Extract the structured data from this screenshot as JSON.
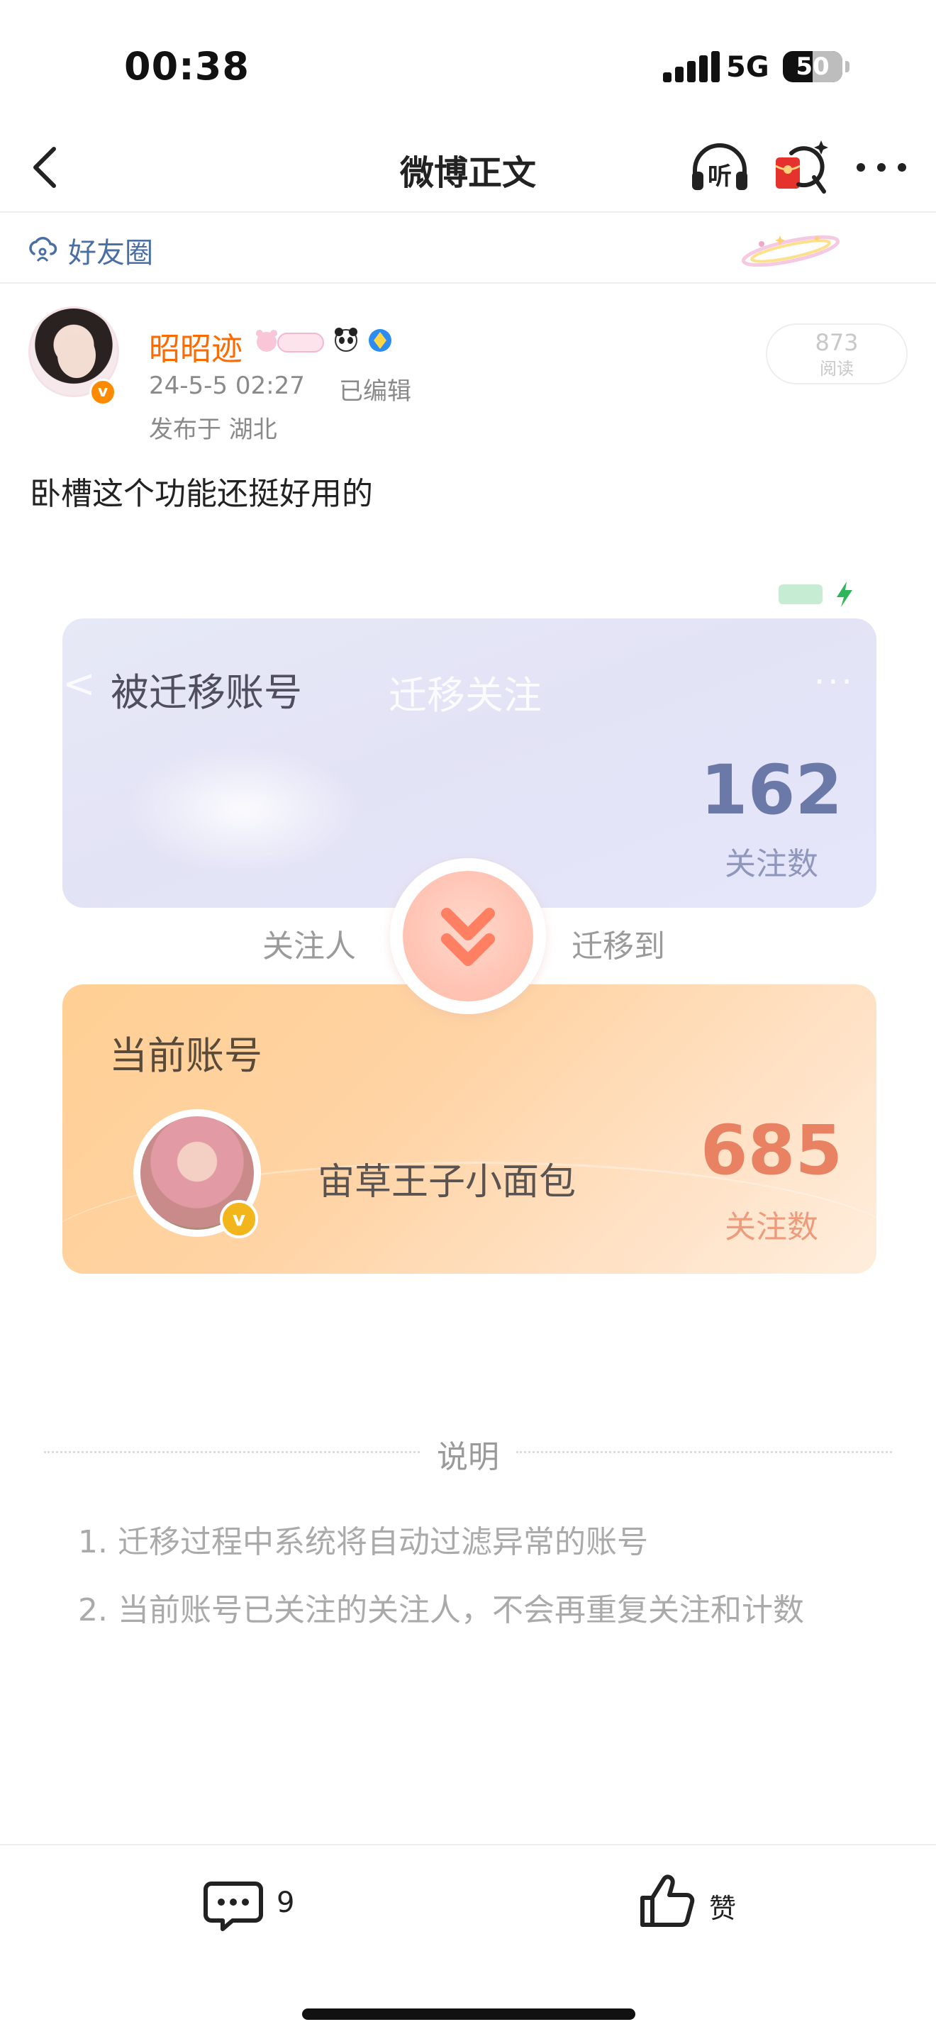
{
  "status_bar": {
    "time": "00:38",
    "network": "5G",
    "battery": "50"
  },
  "nav": {
    "title": "微博正文",
    "listen_icon_text": "听"
  },
  "circle": {
    "label": "好友圈"
  },
  "post": {
    "author": "昭昭迹",
    "time": "24-5-5 02:27",
    "edited": "已编辑",
    "location": "发布于 湖北",
    "read_count": "873",
    "read_label": "阅读",
    "text": "卧槽这个功能还挺好用的"
  },
  "embed": {
    "ghost_back": "<",
    "ghost_title": "迁移关注",
    "ghost_more": "···",
    "top_card": {
      "title": "被迁移账号",
      "count": "162",
      "count_label": "关注数"
    },
    "follow_person_label": "关注人",
    "migrate_to_label": "迁移到",
    "bottom_card": {
      "title": "当前账号",
      "account_name": "宙草王子小面包",
      "count": "685",
      "count_label": "关注数"
    },
    "description": {
      "title": "说明",
      "items": [
        "1. 迁移过程中系统将自动过滤异常的账号",
        "2. 当前账号已关注的关注人，不会再重复关注和计数"
      ]
    }
  },
  "actions": {
    "comment_count": "9",
    "like_label": "赞"
  },
  "colors": {
    "author": "#ff6a00",
    "link": "#4a6fa5",
    "follow_count_top": "#6b79a8",
    "follow_count_bottom": "#e88262"
  }
}
